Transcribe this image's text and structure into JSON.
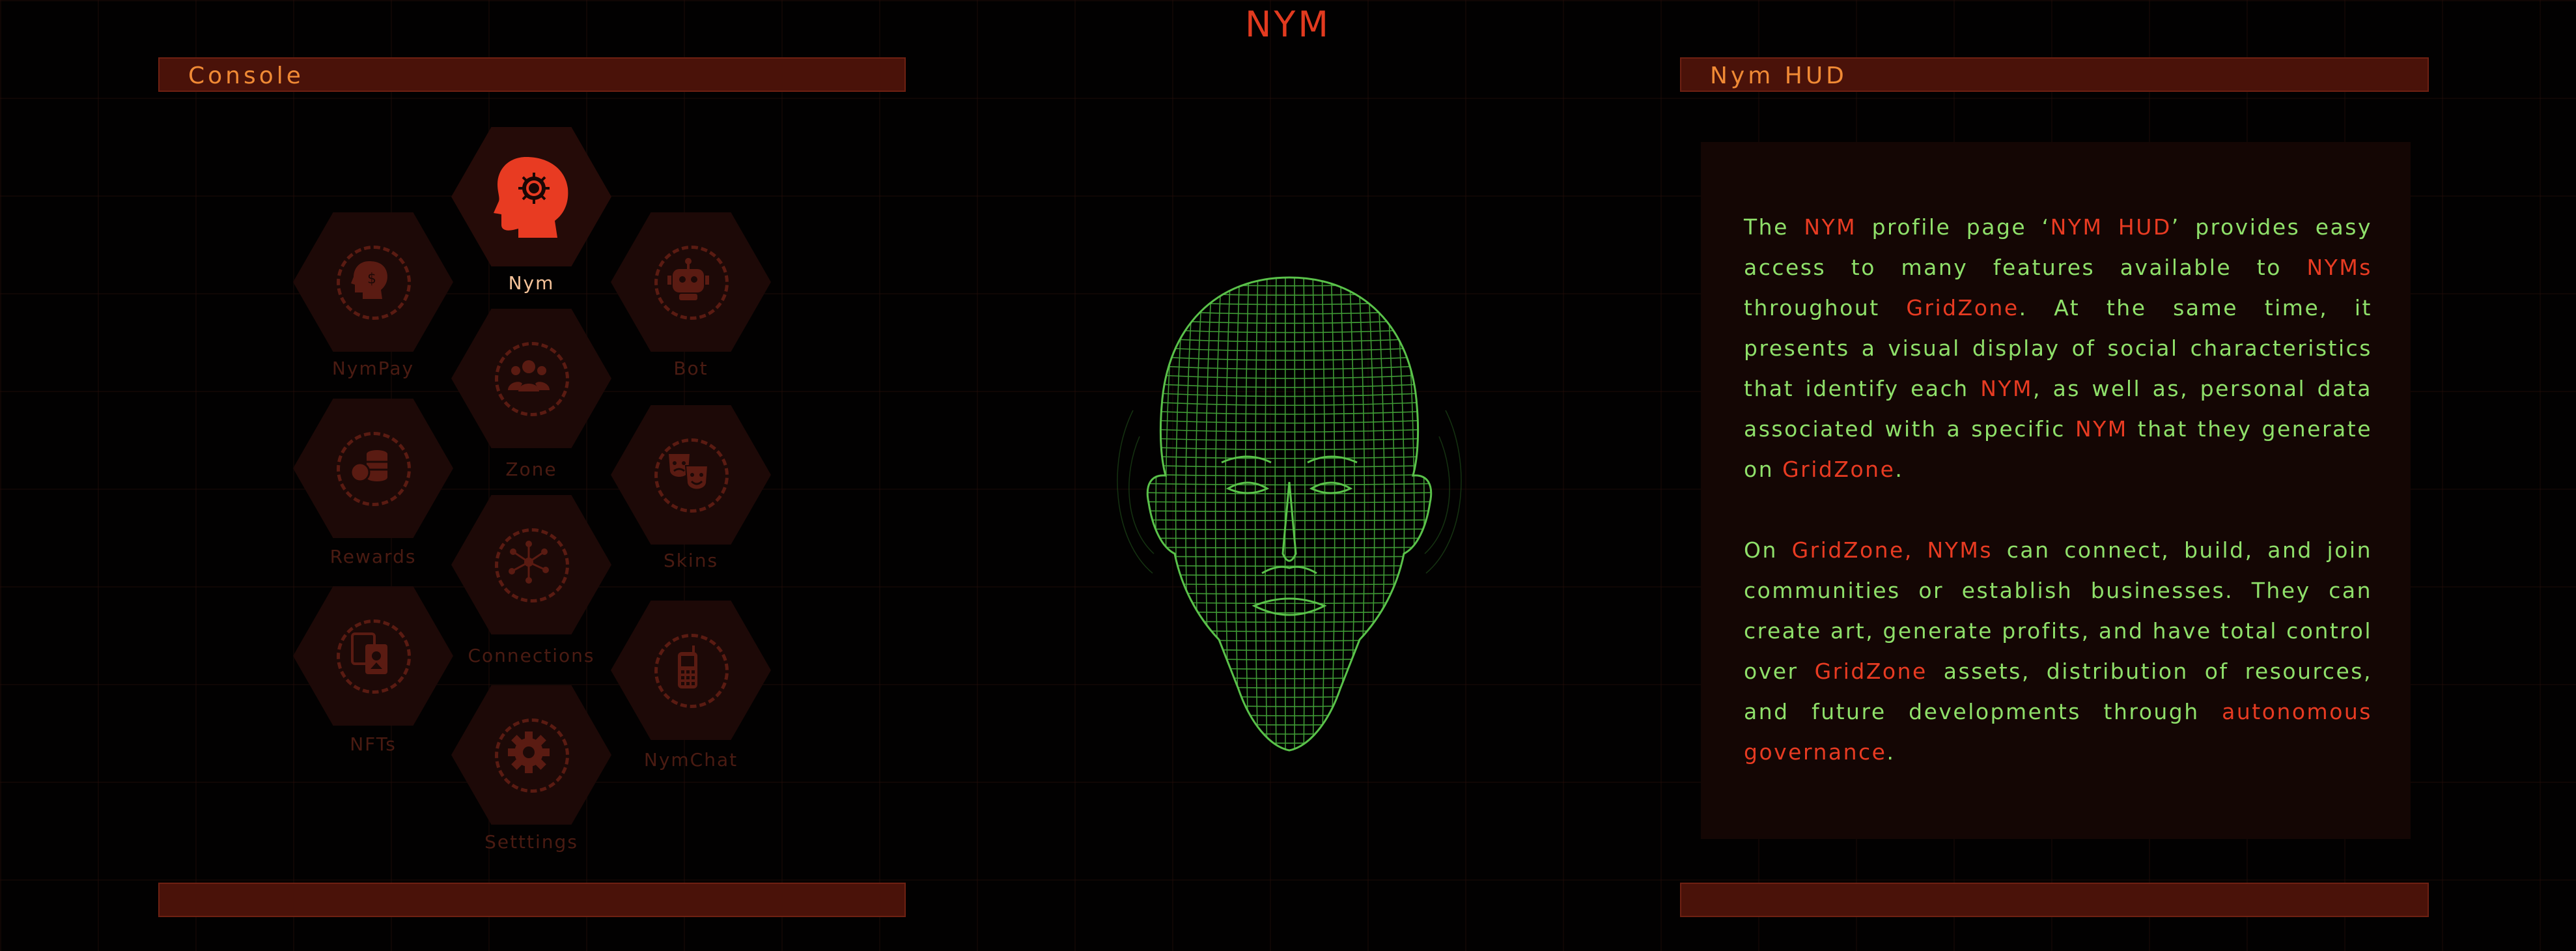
{
  "app": {
    "title": "NYM"
  },
  "console": {
    "title": "Console",
    "items": [
      {
        "label": "Nym",
        "icon": "brain-head-icon",
        "active": true
      },
      {
        "label": "NymPay",
        "icon": "head-dollar-icon",
        "active": false
      },
      {
        "label": "Bot",
        "icon": "robot-icon",
        "active": false
      },
      {
        "label": "Zone",
        "icon": "group-icon",
        "active": false
      },
      {
        "label": "Rewards",
        "icon": "coins-icon",
        "active": false
      },
      {
        "label": "Skins",
        "icon": "theater-masks-icon",
        "active": false
      },
      {
        "label": "Connections",
        "icon": "network-icon",
        "active": false
      },
      {
        "label": "NFTs",
        "icon": "nft-cards-icon",
        "active": false
      },
      {
        "label": "NymChat",
        "icon": "phone-icon",
        "active": false
      },
      {
        "label": "Setttings",
        "icon": "gear-icon",
        "active": false
      }
    ]
  },
  "hud": {
    "title": "Nym HUD",
    "p1": [
      {
        "t": "The ",
        "hl": false
      },
      {
        "t": "NYM",
        "hl": true
      },
      {
        "t": " profile page ‘",
        "hl": false
      },
      {
        "t": "NYM HUD",
        "hl": true
      },
      {
        "t": "’ provides easy access to many features available to ",
        "hl": false
      },
      {
        "t": "NYMs",
        "hl": true
      },
      {
        "t": " throughout ",
        "hl": false
      },
      {
        "t": "GridZone",
        "hl": true
      },
      {
        "t": ". At the same time, it presents a visual display of social characteristics that identify each ",
        "hl": false
      },
      {
        "t": "NYM",
        "hl": true
      },
      {
        "t": ", as well as, personal data associated with a specific ",
        "hl": false
      },
      {
        "t": "NYM",
        "hl": true
      },
      {
        "t": " that they generate on ",
        "hl": false
      },
      {
        "t": "GridZone",
        "hl": true
      },
      {
        "t": ".",
        "hl": false
      }
    ],
    "p2": [
      {
        "t": "On ",
        "hl": false
      },
      {
        "t": "GridZone, NYMs",
        "hl": true
      },
      {
        "t": " can connect, build, and join communities or establish businesses. They can create art, generate profits, and have total control over ",
        "hl": false
      },
      {
        "t": "GridZone",
        "hl": true
      },
      {
        "t": " assets, distribution of resources, and future developments through ",
        "hl": false
      },
      {
        "t": "autonomous governance",
        "hl": true
      },
      {
        "t": ".",
        "hl": false
      }
    ]
  },
  "colors": {
    "accent": "#e83b22",
    "hud_text": "#8fe06a",
    "bar": "#4a1209",
    "head_wire": "#3f9a35"
  }
}
